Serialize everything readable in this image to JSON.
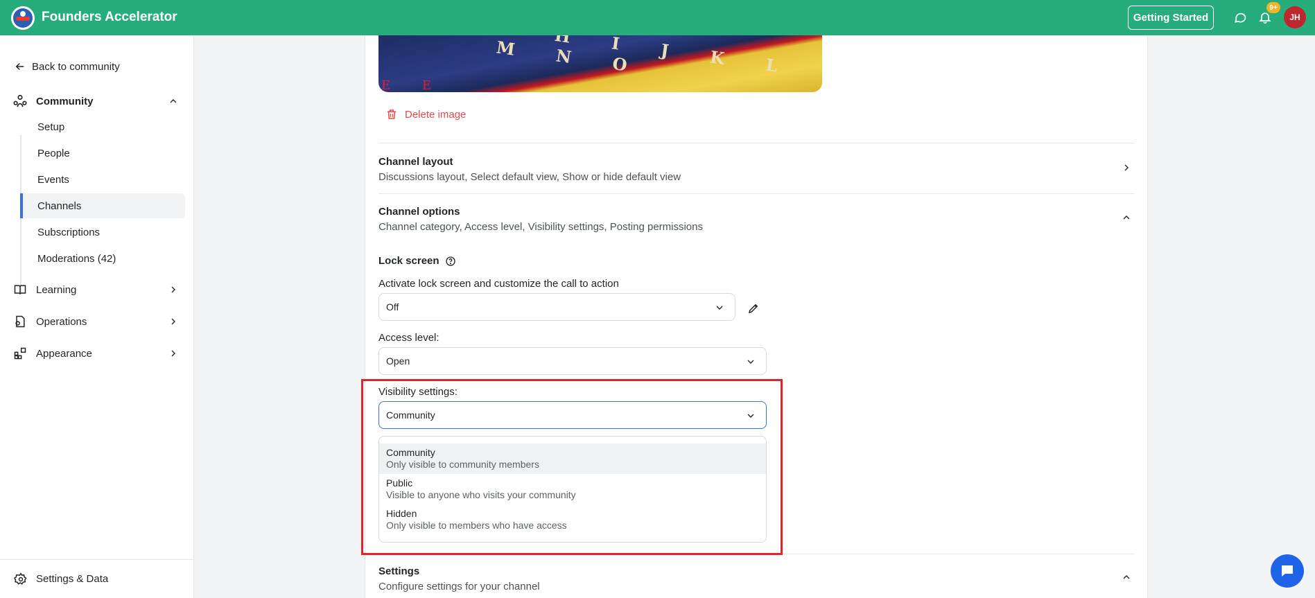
{
  "header": {
    "brand": "Founders Accelerator",
    "getting_started": "Getting Started",
    "notification_badge": "9+",
    "avatar_initials": "JH",
    "brand_color": "#26ad7b"
  },
  "sidebar": {
    "back_label": "Back to community",
    "community": {
      "label": "Community",
      "items": [
        {
          "label": "Setup"
        },
        {
          "label": "People"
        },
        {
          "label": "Events"
        },
        {
          "label": "Channels",
          "active": true
        },
        {
          "label": "Subscriptions"
        },
        {
          "label": "Moderations  (42)"
        }
      ]
    },
    "sections": [
      {
        "label": "Learning",
        "icon": "book-icon"
      },
      {
        "label": "Operations",
        "icon": "operations-icon"
      },
      {
        "label": "Appearance",
        "icon": "appearance-icon"
      }
    ],
    "settings_label": "Settings & Data"
  },
  "main": {
    "banner_letters": "G H I J K L M N O",
    "banner_red": "E E",
    "delete_image": "Delete image",
    "channel_layout": {
      "title": "Channel layout",
      "desc": "Discussions layout, Select default view, Show or hide default view"
    },
    "channel_options": {
      "title": "Channel options",
      "desc": "Channel category, Access level, Visibility settings, Posting permissions"
    },
    "lock_screen": {
      "title": "Lock screen",
      "label": "Activate lock screen and customize the call to action",
      "value": "Off"
    },
    "access_level": {
      "label": "Access level:",
      "value": "Open"
    },
    "visibility": {
      "label": "Visibility settings:",
      "value": "Community",
      "options": [
        {
          "title": "Community",
          "desc": "Only visible to community members",
          "highlighted": true
        },
        {
          "title": "Public",
          "desc": "Visible to anyone who visits your community"
        },
        {
          "title": "Hidden",
          "desc": "Only visible to members who have access"
        }
      ]
    },
    "settings": {
      "title": "Settings",
      "desc": "Configure settings for your channel"
    }
  },
  "colors": {
    "accent": "#3b6fe0",
    "danger": "#e5484d",
    "annotation_box": "#e0262d"
  }
}
